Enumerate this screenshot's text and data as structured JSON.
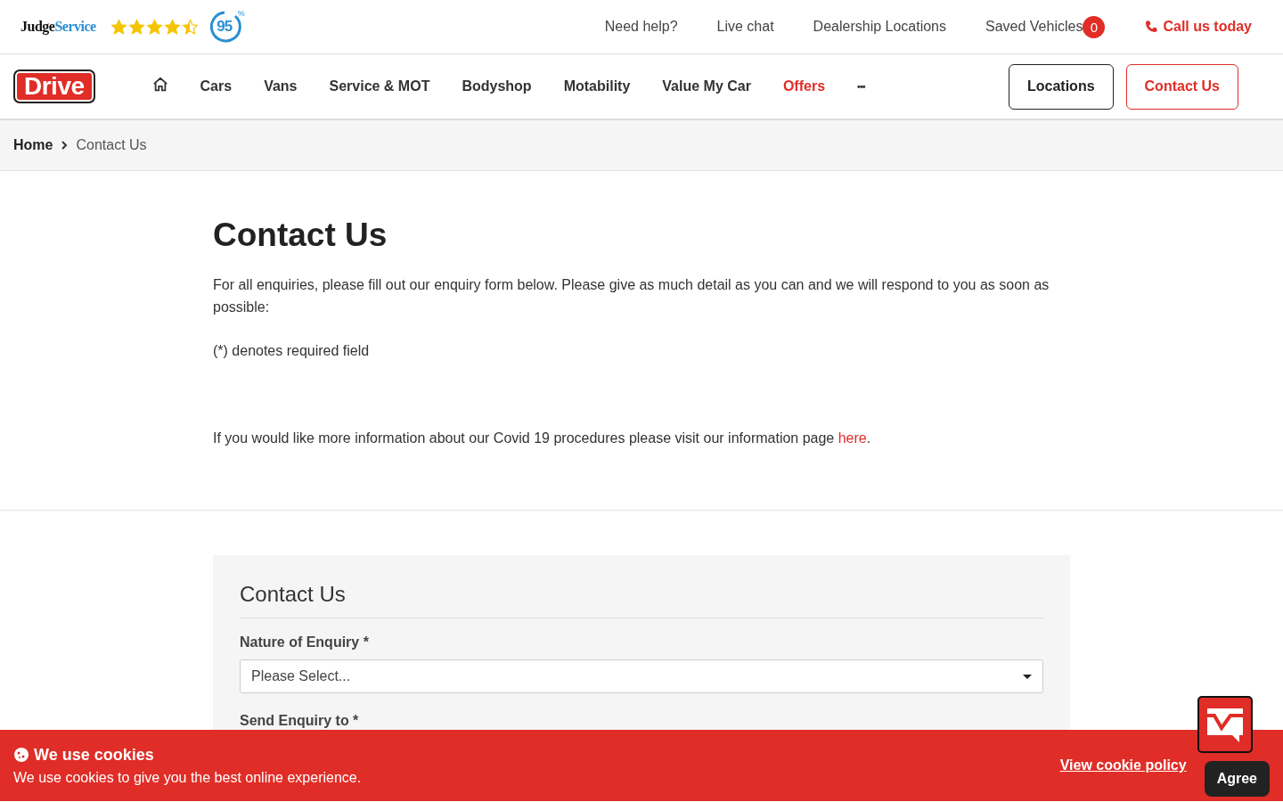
{
  "top_bar": {
    "rating_brand": {
      "part_1": "Judge",
      "part_2": "Service"
    },
    "stars": 4.5,
    "score": "95",
    "score_unit": "%",
    "links": [
      {
        "label": "Need help?"
      },
      {
        "label": "Live chat"
      },
      {
        "label": "Dealership Locations"
      }
    ],
    "saved_vehicles": {
      "label": "Saved Vehicles",
      "count": "0"
    },
    "call": "Call us today"
  },
  "nav": {
    "logo": "Drive",
    "items": [
      {
        "label": "Cars",
        "highlighted": false
      },
      {
        "label": "Vans",
        "highlighted": false
      },
      {
        "label": "Service & MOT",
        "highlighted": false
      },
      {
        "label": "Bodyshop",
        "highlighted": false
      },
      {
        "label": "Motability",
        "highlighted": false
      },
      {
        "label": "Value My Car",
        "highlighted": false
      },
      {
        "label": "Offers",
        "highlighted": true
      }
    ],
    "more": "•••",
    "buttons": [
      {
        "label": "Locations",
        "kind": "dark"
      },
      {
        "label": "Contact Us",
        "kind": "red"
      }
    ]
  },
  "breadcrumb": [
    {
      "label": "Home"
    },
    {
      "label": "Contact Us"
    }
  ],
  "intro": {
    "title": "Contact Us",
    "text": "For all enquiries, please fill out our enquiry form below. Please give as much detail as you can and we will respond to you as soon as possible:",
    "required_note": "(*) denotes required field",
    "covid_text": "If you would like more information about our Covid 19 procedures please visit our information page ",
    "covid_link": "here",
    "covid_end": "."
  },
  "form": {
    "title": "Contact Us",
    "fields": [
      {
        "label": "Nature of Enquiry *",
        "placeholder": "Please Select..."
      }
    ],
    "next_label": "Send Enquiry to *"
  },
  "cookie_banner": {
    "title": "We use cookies",
    "text": "We use cookies to give you the best online experience.",
    "policy_link": "View cookie policy",
    "agree": "Agree"
  }
}
